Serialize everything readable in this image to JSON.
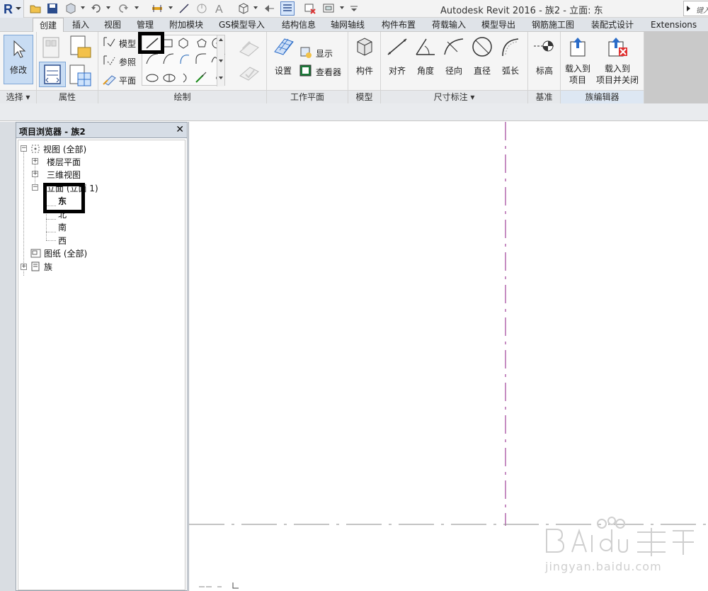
{
  "window": {
    "title": "Autodesk Revit 2016 -    族2 - 立面: 东",
    "search_placeholder": "键入"
  },
  "tabs": [
    "创建",
    "插入",
    "视图",
    "管理",
    "附加模块",
    "GS模型导入",
    "结构信息",
    "轴网轴线",
    "构件布置",
    "荷载输入",
    "模型导出",
    "钢筋施工图",
    "装配式设计",
    "Extensions"
  ],
  "ribbon": {
    "modify": "修改",
    "draw_labels": {
      "model": "模型",
      "reference": "参照",
      "plane": "平面"
    },
    "workplane": {
      "set": "设置",
      "show": "显示",
      "viewer": "查看器"
    },
    "model": {
      "component": "构件"
    },
    "dimension": {
      "aligned": "对齐",
      "angular": "角度",
      "radial": "径向",
      "diameter": "直径",
      "arc": "弧长"
    },
    "datum": {
      "spot_elevation": "标高"
    },
    "family_editor": {
      "load_to_project_line1": "载入到",
      "load_to_project_line2": "项目",
      "load_close_line1": "载入到",
      "load_close_line2": "项目并关闭"
    },
    "panels": {
      "select": "选择",
      "properties": "属性",
      "draw": "绘制",
      "workplane": "工作平面",
      "model": "模型",
      "dimension": "尺寸标注",
      "datum": "基准",
      "family_editor": "族编辑器"
    }
  },
  "browser": {
    "title": "项目浏览器 - 族2",
    "close": "✕",
    "tree": {
      "views": "视图 (全部)",
      "floor_plans": "楼层平面",
      "three_d": "三维视图",
      "elevations": "立面 (立面 1)",
      "east": "东",
      "north": "北",
      "south": "南",
      "west": "西",
      "sheets": "图纸 (全部)",
      "families": "族"
    }
  },
  "watermark": {
    "text": "jingyan.baidu.com"
  },
  "colors": {
    "ref_plane": "#a0429a",
    "tab_bar": "#dfe3e8",
    "ribbon": "#f5f5f5"
  }
}
